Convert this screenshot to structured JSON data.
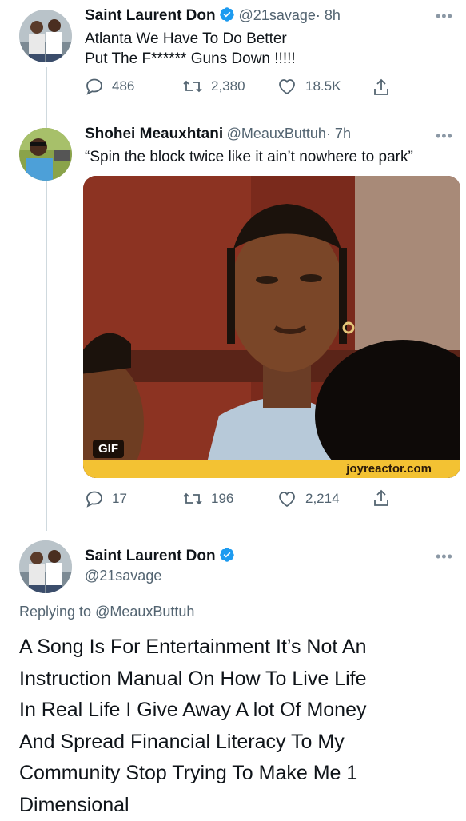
{
  "tweet1": {
    "name": "Saint Laurent Don",
    "handle": "@21savage",
    "time": "· 8h",
    "line1": "Atlanta We Have To Do Better",
    "line2": "Put The F****** Guns Down !!!!!",
    "replies": "486",
    "retweets": "2,380",
    "likes": "18.5K",
    "more": "•••"
  },
  "tweet2": {
    "name": "Shohei Meauxhtani",
    "handle": "@MeauxButtuh",
    "time": "· 7h",
    "text": "“Spin the block twice like it ain’t nowhere to park”",
    "gif_badge": "GIF",
    "watermark": "joyreactor.com",
    "replies": "17",
    "retweets": "196",
    "likes": "2,214",
    "more": "•••"
  },
  "tweet3": {
    "name": "Saint Laurent Don",
    "handle": "@21savage",
    "replying_prefix": "Replying to ",
    "replying_to": "@MeauxButtuh",
    "line1": "A Song Is For Entertainment It’s Not An",
    "line2": "Instruction Manual On How To Live Life",
    "line3": "In Real Life I Give Away A lot Of Money",
    "line4": "And Spread Financial Literacy To My",
    "line5": "Community Stop Trying To Make Me 1",
    "line6": "Dimensional",
    "more": "•••"
  },
  "colors": {
    "verified": "#1d9bf0",
    "link": "#536471",
    "secondary_text": "#536471",
    "thread_line": "#cfd9de"
  },
  "icons": [
    "reply-icon",
    "retweet-icon",
    "like-icon",
    "share-icon",
    "verified-badge-icon",
    "more-icon"
  ]
}
